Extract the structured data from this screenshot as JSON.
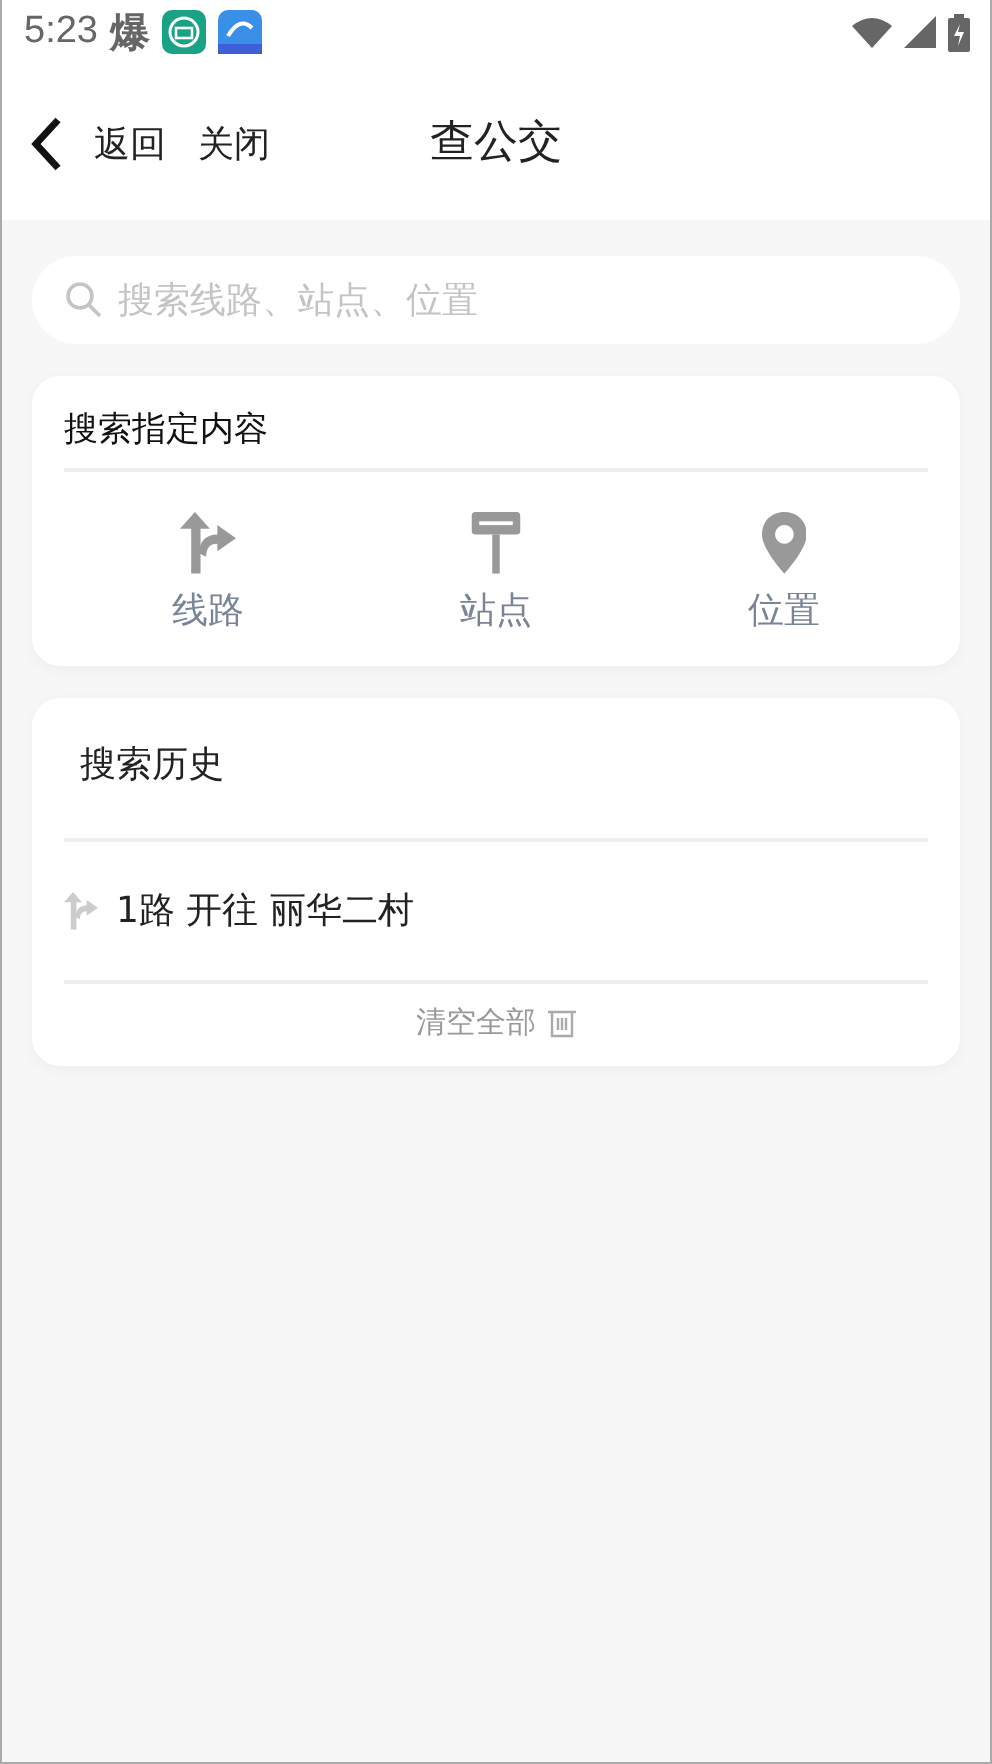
{
  "status_bar": {
    "time": "5:23",
    "notification": "爆"
  },
  "nav": {
    "back": "返回",
    "close": "关闭",
    "title": "查公交"
  },
  "search": {
    "placeholder": "搜索线路、站点、位置"
  },
  "search_types": {
    "title": "搜索指定内容",
    "items": [
      {
        "kind": "route",
        "label": "线路"
      },
      {
        "kind": "stop",
        "label": "站点"
      },
      {
        "kind": "location",
        "label": "位置"
      }
    ]
  },
  "history": {
    "title": "搜索历史",
    "items": [
      {
        "kind": "route",
        "text": "1路 开往 丽华二村"
      }
    ],
    "clear": "清空全部"
  }
}
